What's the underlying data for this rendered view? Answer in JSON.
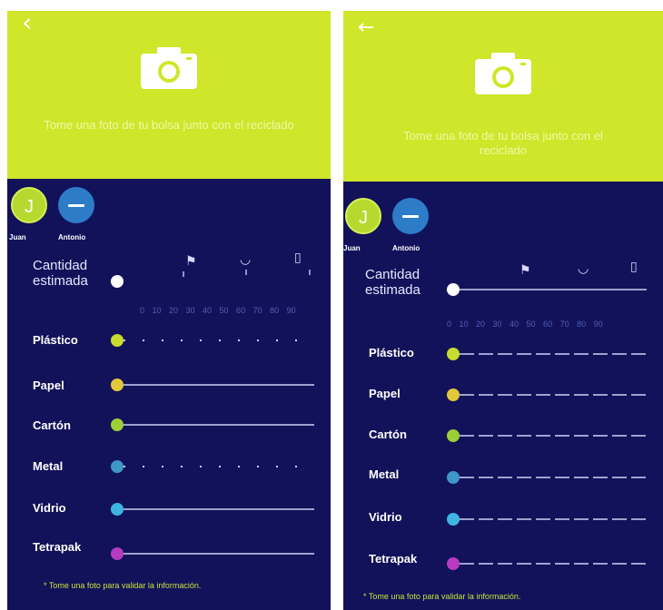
{
  "hero": {
    "back_icon": "arrow-left-icon",
    "camera_icon": "camera-icon",
    "message": "Tome una foto de tu bolsa junto con el reciclado"
  },
  "users": [
    {
      "initial": "J",
      "name": "Juan"
    },
    {
      "initial": "",
      "name": "Antonio"
    }
  ],
  "quantity": {
    "label_line1": "Cantidad",
    "label_line2": "estimada",
    "icons": [
      "flag-icon",
      "bag-icon",
      "bottle-icon"
    ],
    "scale": "0 10 20 30 40 50 60 70 80 90"
  },
  "materials": [
    {
      "label": "Plástico",
      "color": "#c8dc2e"
    },
    {
      "label": "Papel",
      "color": "#e3c73a"
    },
    {
      "label": "Cartón",
      "color": "#9ccf35"
    },
    {
      "label": "Metal",
      "color": "#3f97c9"
    },
    {
      "label": "Vidrio",
      "color": "#3fb4e0"
    },
    {
      "label": "Tetrapak",
      "color": "#b63bc0"
    }
  ],
  "footnote": "* Tome una foto para validar la información.",
  "colors": {
    "accent": "#cfe62a",
    "background": "#12125a",
    "track": "#9da3cf"
  }
}
